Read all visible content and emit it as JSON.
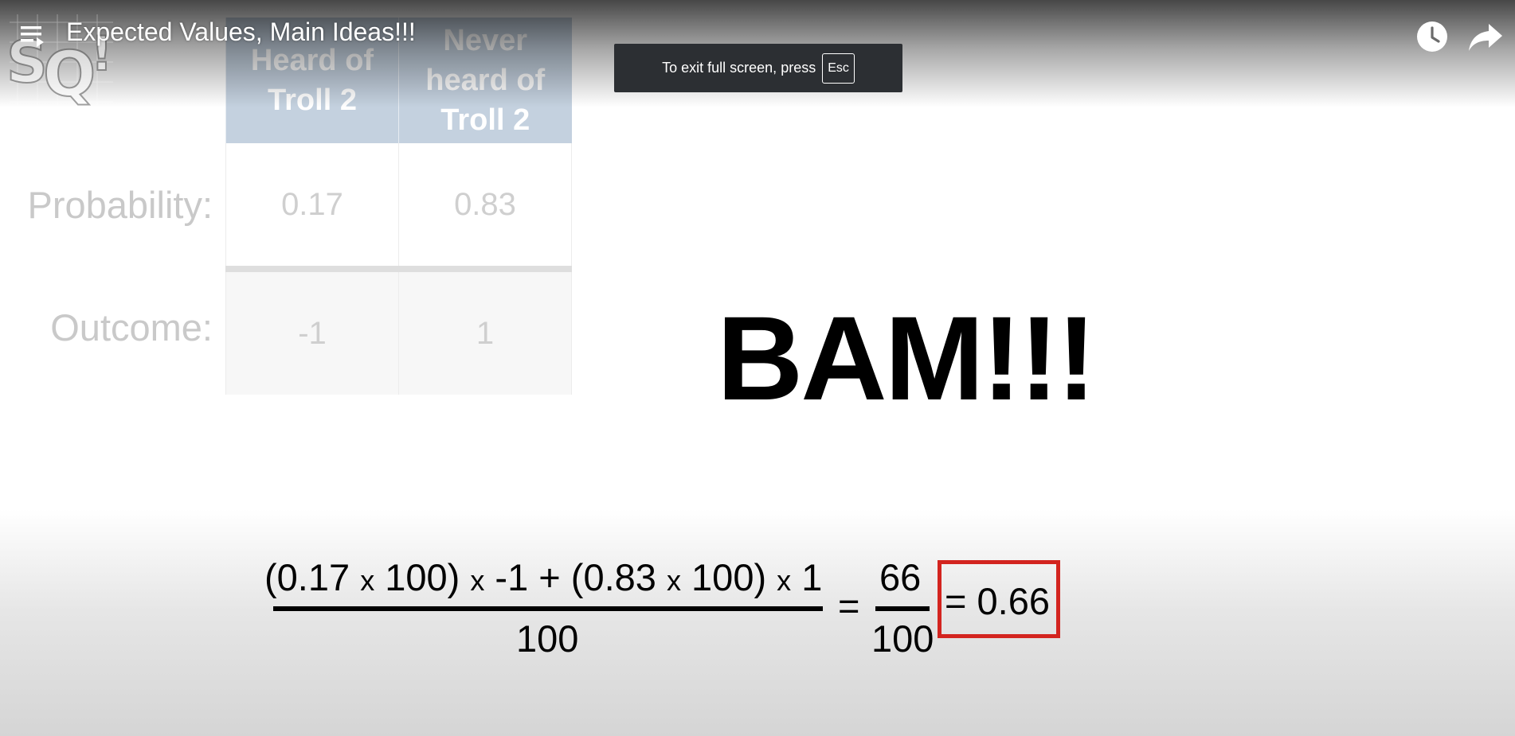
{
  "player": {
    "title": "Expected Values, Main Ideas!!!",
    "fullscreen_hint": {
      "text": "To exit full screen, press",
      "key": "Esc"
    },
    "icons": {
      "menu": "playlist-icon",
      "watch_later": "clock-icon",
      "share": "share-arrow-icon"
    }
  },
  "slide": {
    "table": {
      "headers": [
        "Heard of Troll 2",
        "Never heard of Troll 2"
      ],
      "rows": [
        {
          "label": "Probability:",
          "values": [
            "0.17",
            "0.83"
          ]
        },
        {
          "label": "Outcome:",
          "values": [
            "-1",
            "1"
          ]
        }
      ]
    },
    "exclamation": "BAM!!!",
    "formula": {
      "numerator_parts": [
        "(0.17 ",
        "x",
        " 100) ",
        "x",
        " -1 + (0.83 ",
        "x",
        " 100) ",
        "x",
        " 1"
      ],
      "denominator": "100",
      "equals": "=",
      "fraction_numerator": "66",
      "fraction_denominator": "100",
      "result": "= 0.66"
    },
    "colors": {
      "result_box": "#d3241f",
      "table_header": "#c4d1df",
      "toast_bg": "#2c2f33"
    }
  }
}
